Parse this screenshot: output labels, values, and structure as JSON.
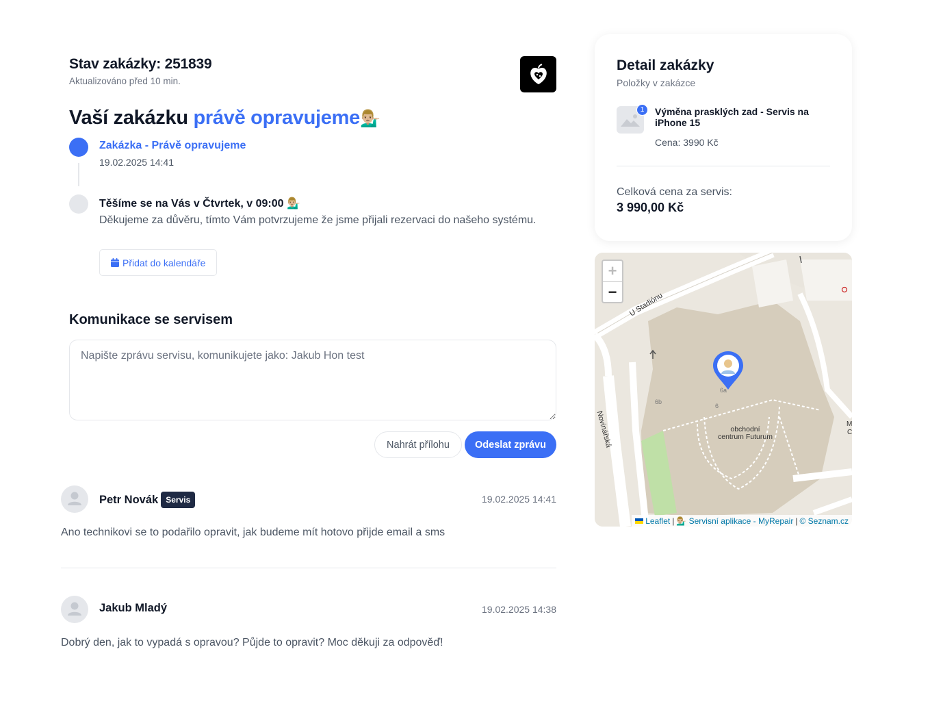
{
  "order": {
    "title": "Stav zakázky: 251839",
    "updated": "Aktualizováno před 10 min."
  },
  "headline": {
    "prefix": "Vaší zakázku",
    "accent": "právě opravujeme",
    "emoji": "💁🏼‍♂️"
  },
  "timeline": [
    {
      "title": "Zakázka - Právě opravujeme",
      "time": "19.02.2025 14:41"
    },
    {
      "title": "Těšíme se na Vás v Čtvrtek, v 09:00 💁🏼‍♂️",
      "text": "Děkujeme za důvěru, tímto Vám potvrzujeme že jsme přijali rezervaci do našeho systému.",
      "button": "Přidat do kalendáře"
    }
  ],
  "communication": {
    "title": "Komunikace se servisem",
    "placeholder": "Napište zprávu servisu, komunikujete jako: Jakub Hon test",
    "upload_label": "Nahrát přílohu",
    "send_label": "Odeslat zprávu"
  },
  "messages": [
    {
      "author": "Petr Novák",
      "badge": "Servis",
      "date": "19.02.2025 14:41",
      "text": "Ano technikovi se to podařilo opravit, jak budeme mít hotovo přijde email a sms"
    },
    {
      "author": "Jakub Mladý",
      "date": "19.02.2025 14:38",
      "text": "Dobrý den, jak to vypadá s opravou? Půjde to opravit? Moc děkuji za odpověď!"
    }
  ],
  "detail": {
    "title": "Detail zakázky",
    "subtitle": "Položky v zakázce",
    "items": [
      {
        "count": "1",
        "name": "Výměna prasklých zad - Servis na iPhone 15",
        "price": "Cena: 3990 Kč"
      }
    ],
    "total_label": "Celková cena za servis:",
    "total_value": "3 990,00 Kč"
  },
  "map": {
    "zoom_in": "+",
    "zoom_out": "−",
    "labels": {
      "street1": "U Stadiónu",
      "street2": "Novinářská",
      "poi_line1": "obchodní",
      "poi_line2": "centrum Futurum",
      "num_6a": "6a",
      "num_6b": "6b",
      "num_6": "6",
      "edge": "M",
      "edge2": "C"
    },
    "attribution": {
      "leaflet": "Leaflet",
      "app": "💁🏼‍♂️ Servisní aplikace - MyRepair",
      "sep": "|",
      "provider": "© Seznam.cz"
    }
  },
  "colors": {
    "accent": "#3b6ff5",
    "badge": "#1f2a44"
  },
  "icons": {
    "brand": "apple-heart-logo-icon",
    "calendar": "calendar-icon",
    "avatar": "user-avatar-icon",
    "thumb": "image-placeholder-icon",
    "pin": "map-pin-icon"
  }
}
